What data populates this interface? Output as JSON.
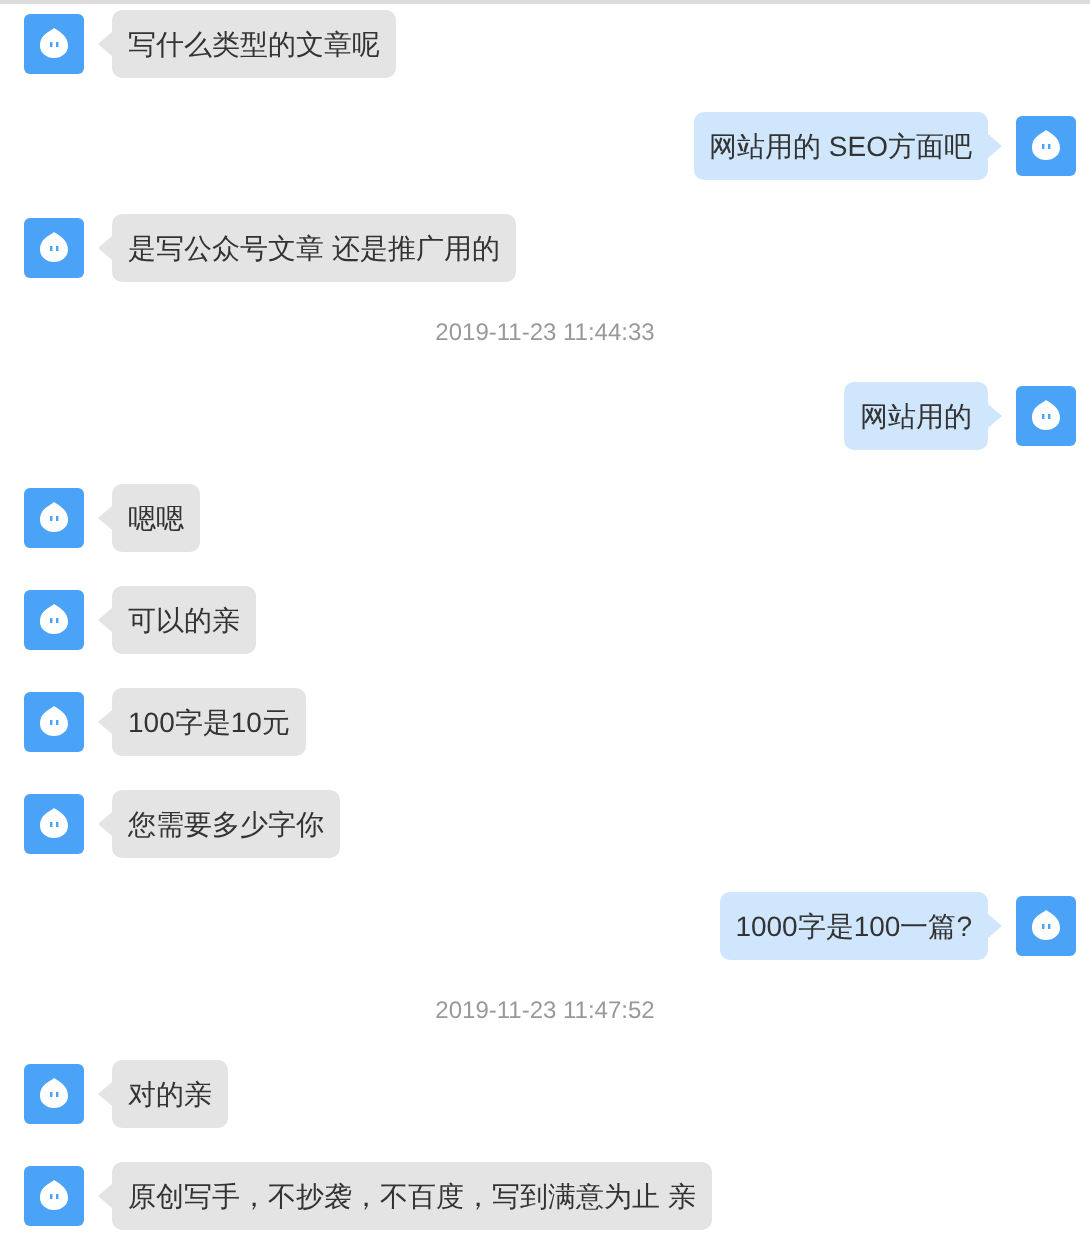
{
  "messages": [
    {
      "kind": "received",
      "text": "写什么类型的文章呢"
    },
    {
      "kind": "sent",
      "text": "网站用的 SEO方面吧"
    },
    {
      "kind": "received",
      "text": "是写公众号文章 还是推广用的"
    },
    {
      "kind": "time",
      "text": "2019-11-23 11:44:33"
    },
    {
      "kind": "sent",
      "text": "网站用的"
    },
    {
      "kind": "received",
      "text": "嗯嗯"
    },
    {
      "kind": "received",
      "text": "可以的亲"
    },
    {
      "kind": "received",
      "text": "100字是10元"
    },
    {
      "kind": "received",
      "text": "您需要多少字你"
    },
    {
      "kind": "sent",
      "text": "1000字是100一篇?"
    },
    {
      "kind": "time",
      "text": "2019-11-23 11:47:52"
    },
    {
      "kind": "received",
      "text": "对的亲"
    },
    {
      "kind": "received",
      "text": "原创写手，不抄袭，不百度，写到满意为止 亲"
    }
  ]
}
